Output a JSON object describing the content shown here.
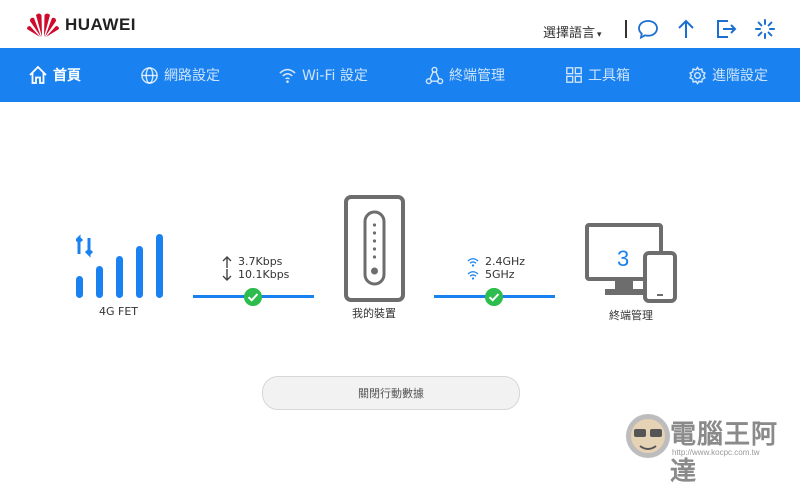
{
  "brand": {
    "name": "HUAWEI",
    "logo_icon": "huawei-petal-logo",
    "logo_color": "#cf0a2c"
  },
  "header": {
    "language_label": "選擇語言",
    "icons": [
      "chat-icon",
      "upload-arrow-icon",
      "logout-icon",
      "loading-spinner-icon"
    ]
  },
  "nav": {
    "accent": "#1a82f0",
    "items": [
      {
        "label": "首頁",
        "icon": "home-icon",
        "active": true
      },
      {
        "label": "網路設定",
        "icon": "globe-icon"
      },
      {
        "label": "Wi-Fi 設定",
        "icon": "wifi-icon"
      },
      {
        "label": "終端管理",
        "icon": "network-tree-icon"
      },
      {
        "label": "工具箱",
        "icon": "toolbox-grid-icon"
      },
      {
        "label": "進階設定",
        "icon": "gear-icon"
      }
    ]
  },
  "dashboard": {
    "network": {
      "label": "4G  FET",
      "signal_bars_lit": 5,
      "signal_bars_total": 5,
      "icon": "signal-strength-icon"
    },
    "upload_rate": "3.7Kbps",
    "download_rate": "10.1Kbps",
    "device": {
      "label": "我的裝置",
      "icon": "router-device-icon"
    },
    "wifi_band_1": "2.4GHz",
    "wifi_band_2": "5GHz",
    "terminals": {
      "label": "終端管理",
      "count": "3",
      "icon": "monitor-phone-icon"
    },
    "status_color": "#2dbd4e",
    "toggle_button": "關閉行動數據"
  },
  "watermark": {
    "text": "電腦王阿達",
    "url": "http://www.kocpc.com.tw"
  }
}
